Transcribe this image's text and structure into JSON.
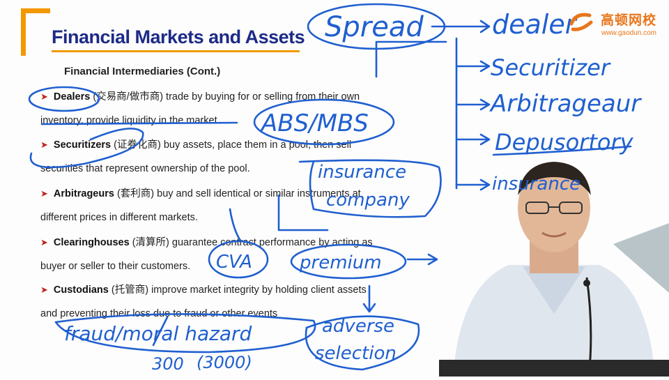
{
  "slide": {
    "title": "Financial Markets and Assets",
    "subheading": "Financial Intermediaries (Cont.)",
    "bullets": [
      {
        "term": "Dealers",
        "rest_line1": "(交易商/做市商) trade by buying for or selling from their own",
        "line2": "inventory, provide liquidity in the market."
      },
      {
        "term": "Securitizers",
        "rest_line1": "(证券化商)  buy assets, place them in a pool, then sell",
        "line2": "securities that represent ownership of the pool."
      },
      {
        "term": "Arbitrageurs",
        "rest_line1": "(套利商) buy and sell identical or similar instruments at",
        "line2": "different prices in different markets."
      },
      {
        "term": "Clearinghouses",
        "rest_line1": "(清算所) guarantee contract performance by acting as",
        "line2": "buyer or seller to their customers."
      },
      {
        "term": "Custodians",
        "rest_line1": "(托管商) improve market integrity by holding client assets",
        "line2": "and preventing their loss due to fraud or other events"
      }
    ]
  },
  "brand": {
    "name": "高顿网校",
    "url": "www.gaodun.com",
    "color": "#e8761b"
  },
  "annotations": {
    "spread": "Spread",
    "dealer": "dealer",
    "securitizer": "Securitizer",
    "arbitrageur": "Arbitrageaur",
    "depository": "Depusortory",
    "insurance_right": "insurance",
    "abs_mbs": "ABS/MBS",
    "insurance_company_1": "insurance",
    "insurance_company_2": "company",
    "cva": "CVA",
    "premium": "premium",
    "fraud_moral_hazard": "fraud/moral hazard",
    "adverse": "adverse",
    "selection": "selection",
    "n300": "300",
    "n3000": "(3000)",
    "ink_color": "#1f5fd0"
  },
  "colors": {
    "title": "#1d2a87",
    "accent_orange": "#f39800",
    "bullet_arrow": "#c0221b"
  }
}
